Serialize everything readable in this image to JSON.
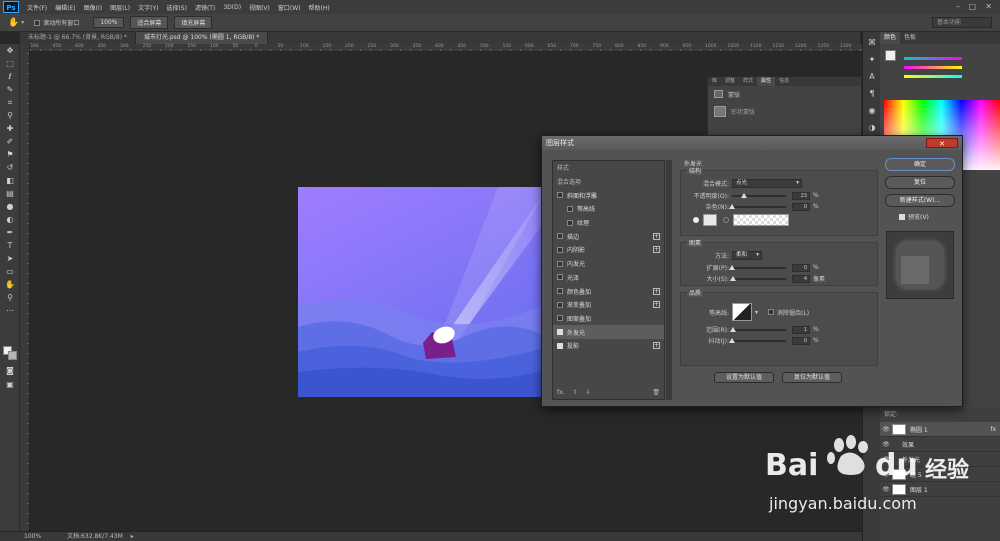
{
  "app": {
    "logo": "Ps"
  },
  "menu": [
    "文件(F)",
    "编辑(E)",
    "图像(I)",
    "图层(L)",
    "文字(Y)",
    "选择(S)",
    "滤镜(T)",
    "3D(D)",
    "视图(V)",
    "窗口(W)",
    "帮助(H)"
  ],
  "options": {
    "scroll_all_label": "滚动所有窗口",
    "zoom_btn": "100%",
    "fit_screen_btn": "适合屏幕",
    "fill_screen_btn": "填充屏幕",
    "workspace": "基本功能"
  },
  "tabs": [
    "未标题-1 @ 66.7% (背景, RGB/8) *",
    "城市灯光.psd @ 100% (椭圆 1, RGB/8) *"
  ],
  "ruler_marks": [
    "500",
    "450",
    "400",
    "350",
    "300",
    "250",
    "200",
    "150",
    "100",
    "50",
    "0",
    "50",
    "100",
    "150",
    "200",
    "250",
    "300",
    "350",
    "400",
    "450",
    "500",
    "550",
    "600",
    "650",
    "700",
    "750",
    "800",
    "850",
    "900",
    "950",
    "1000",
    "1050",
    "1100",
    "1150",
    "1200",
    "1250",
    "1300"
  ],
  "statusbar": {
    "zoom": "100%",
    "doc": "文档:632.8K/7.43M"
  },
  "right_panel": {
    "color_tabs": [
      "颜色",
      "色板"
    ],
    "props_tabs": [
      "库",
      "调整",
      "样式",
      "属性",
      "信息"
    ],
    "props_title": "蒙版",
    "props_sub": "形状蒙版"
  },
  "layers": {
    "header": "锁定:",
    "items": [
      {
        "name": "椭圆 1",
        "fx": "fx"
      },
      {
        "name": "效果"
      },
      {
        "name": "外发光"
      },
      {
        "name": "组 5"
      },
      {
        "name": "图层 1"
      }
    ]
  },
  "dialog": {
    "title": "图层样式",
    "close": "✕",
    "styles": [
      {
        "label": "样式",
        "type": "header"
      },
      {
        "label": "混合选项",
        "type": "header"
      },
      {
        "label": "斜面和浮雕",
        "checked": false
      },
      {
        "label": "等高线",
        "checked": false,
        "indent": true
      },
      {
        "label": "纹理",
        "checked": false,
        "indent": true
      },
      {
        "label": "描边",
        "checked": false,
        "plus": true
      },
      {
        "label": "内阴影",
        "checked": false,
        "plus": true
      },
      {
        "label": "内发光",
        "checked": false
      },
      {
        "label": "光泽",
        "checked": false
      },
      {
        "label": "颜色叠加",
        "checked": false,
        "plus": true
      },
      {
        "label": "渐变叠加",
        "checked": false,
        "plus": true
      },
      {
        "label": "图案叠加",
        "checked": false
      },
      {
        "label": "外发光",
        "checked": true,
        "selected": true
      },
      {
        "label": "投影",
        "checked": true,
        "plus": true
      }
    ],
    "footer": [
      "fx.",
      "⇧",
      "⇩",
      "🗑"
    ],
    "section_title": "外发光",
    "structure": {
      "title": "结构",
      "blend_mode_label": "混合模式:",
      "blend_mode": "点光",
      "opacity_label": "不透明度(O):",
      "opacity": "23",
      "opacity_unit": "%",
      "opacity_level": 0.23,
      "noise_label": "杂色(N):",
      "noise": "0",
      "noise_unit": "%",
      "noise_level": 0
    },
    "elements": {
      "title": "图素",
      "method_label": "方法:",
      "method": "柔和",
      "spread_label": "扩展(P):",
      "spread": "0",
      "spread_unit": "%",
      "spread_level": 0,
      "size_label": "大小(S):",
      "size": "4",
      "size_unit": "像素",
      "size_level": 0.02
    },
    "quality": {
      "title": "品质",
      "contour_label": "等高线:",
      "antialias_label": "消除锯齿(L)",
      "range_label": "范围(R):",
      "range": "1",
      "range_unit": "%",
      "range_level": 0.01,
      "jitter_label": "抖动(J):",
      "jitter": "0",
      "jitter_unit": "%",
      "jitter_level": 0
    },
    "set_default": "设置为默认值",
    "reset_default": "复位为默认值",
    "buttons": {
      "ok": "确定",
      "reset": "复位",
      "new_style": "新建样式(W)...",
      "preview": "预览(V)"
    }
  },
  "watermark": {
    "brand": "Bai",
    "brand2": "du",
    "sub": "经验",
    "url": "jingyan.baidu.com"
  },
  "colors": {
    "accent": "#31a8ff",
    "close": "#c0392b",
    "artwork_top": "#9b7cff",
    "artwork_bottom": "#3f63d4"
  }
}
